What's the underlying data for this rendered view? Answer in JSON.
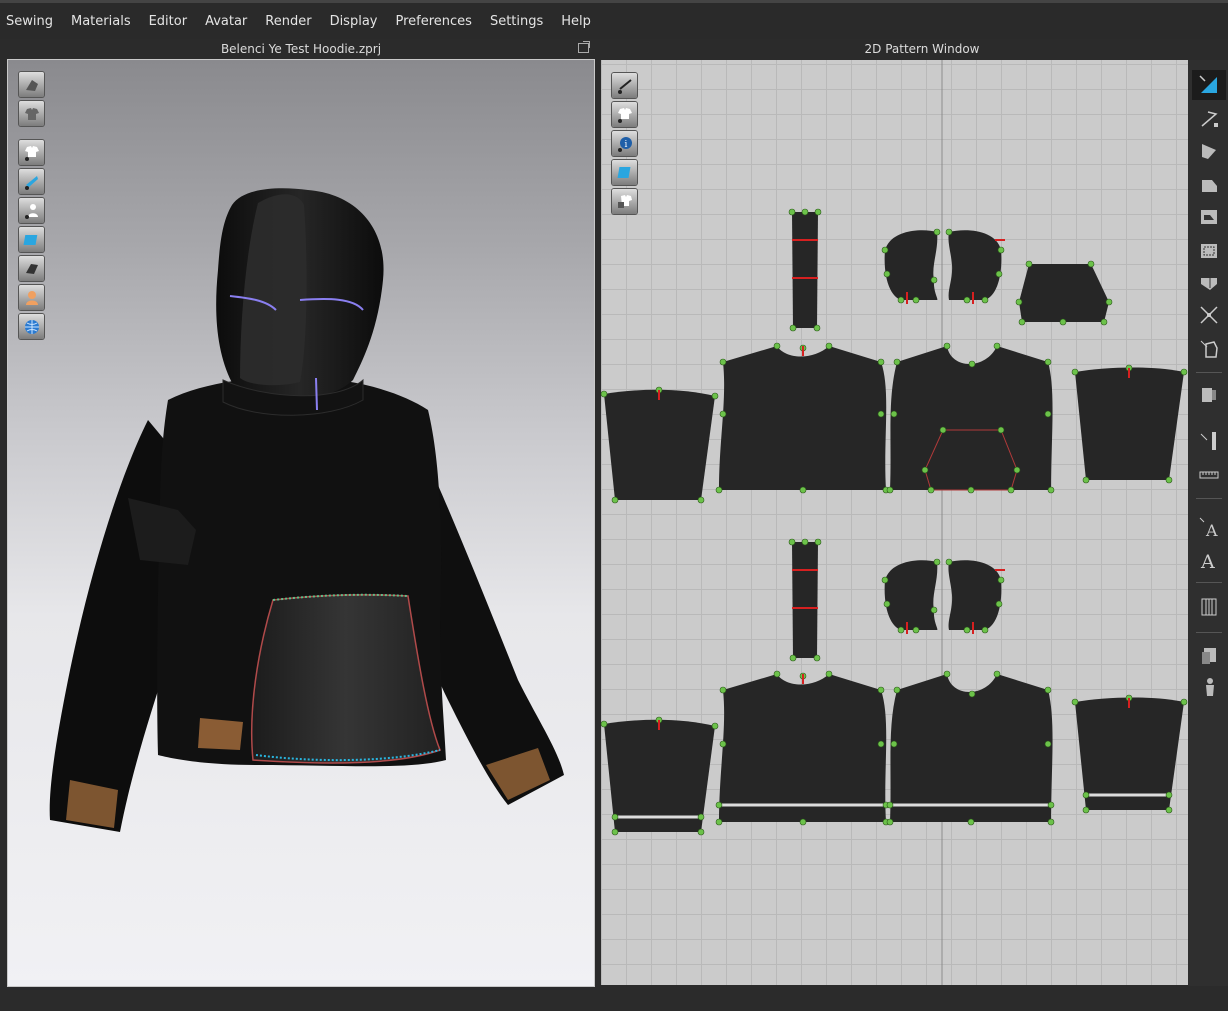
{
  "menu": {
    "items": [
      "Sewing",
      "Materials",
      "Editor",
      "Avatar",
      "Render",
      "Display",
      "Preferences",
      "Settings",
      "Help"
    ]
  },
  "window_3d": {
    "title": "Belenci Ye Test Hoodie.zprj",
    "tools": [
      "simulation-icon",
      "garment-shape-icon",
      "show-garment-icon",
      "show-pins-icon",
      "show-avatar-icon",
      "texture-view-icon",
      "thickness-icon",
      "avatar-skin-icon",
      "mesh-globe-icon"
    ]
  },
  "window_2d": {
    "title": "2D Pattern Window",
    "tools": [
      "show-sewing-icon",
      "show-pattern-icon",
      "info-icon",
      "texture-2d-icon",
      "lock-pattern-icon"
    ]
  },
  "right_toolbar": {
    "tools": [
      "transform-pattern-icon",
      "edit-point-icon",
      "polygon-icon",
      "rectangle-icon",
      "internal-polygon-icon",
      "internal-rectangle-icon",
      "dart-icon",
      "trace-icon",
      "cut-pattern-icon",
      "segment-sewing-icon",
      "ruler-icon",
      "tape-icon",
      "text-edit-icon",
      "text-add-icon",
      "grading-icon",
      "fold-arrangement-icon",
      "avatar-pose-icon"
    ]
  },
  "colors": {
    "accent": "#2aa6e0",
    "point": "#6cc24a",
    "notch": "#d62020",
    "fabric": "#1a1a1a",
    "pattern": "#262626",
    "rib": "#8a5c34"
  }
}
